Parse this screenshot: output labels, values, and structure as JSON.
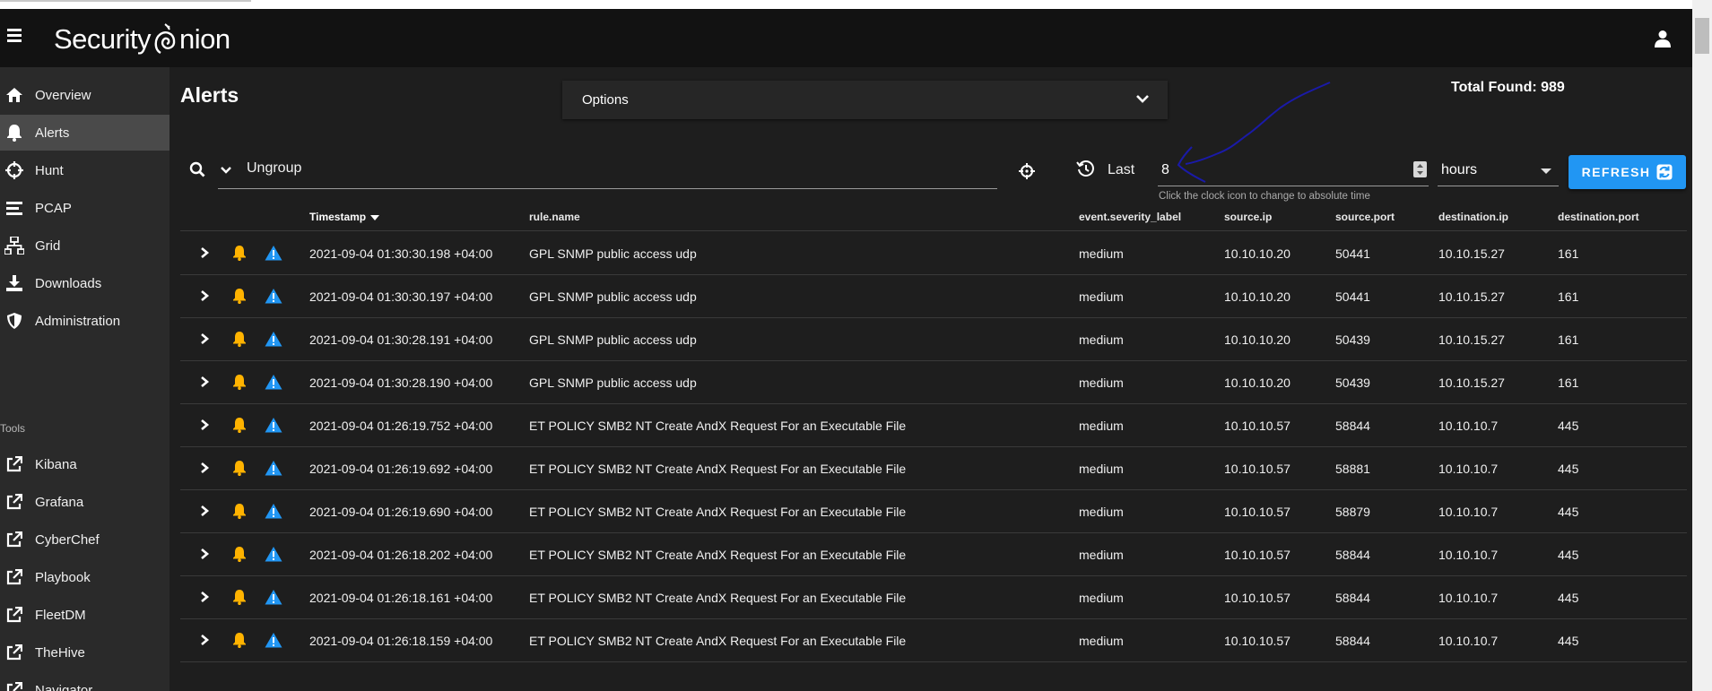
{
  "app": {
    "brand": "Security Onion"
  },
  "sidebar": {
    "items": [
      {
        "label": "Overview",
        "icon": "home-icon",
        "active": false
      },
      {
        "label": "Alerts",
        "icon": "bell-icon",
        "active": true
      },
      {
        "label": "Hunt",
        "icon": "crosshair-icon",
        "active": false
      },
      {
        "label": "PCAP",
        "icon": "list-bars-icon",
        "active": false
      },
      {
        "label": "Grid",
        "icon": "sitemap-icon",
        "active": false
      },
      {
        "label": "Downloads",
        "icon": "download-icon",
        "active": false
      },
      {
        "label": "Administration",
        "icon": "shield-icon",
        "active": false
      }
    ],
    "tools_label": "Tools",
    "tools": [
      {
        "label": "Kibana",
        "icon": "external-link-icon"
      },
      {
        "label": "Grafana",
        "icon": "external-link-icon"
      },
      {
        "label": "CyberChef",
        "icon": "external-link-icon"
      },
      {
        "label": "Playbook",
        "icon": "external-link-icon"
      },
      {
        "label": "FleetDM",
        "icon": "external-link-icon"
      },
      {
        "label": "TheHive",
        "icon": "external-link-icon"
      },
      {
        "label": "Navigator",
        "icon": "external-link-icon"
      }
    ]
  },
  "main": {
    "title": "Alerts",
    "options_label": "Options",
    "total_found": "Total Found: 989"
  },
  "query": {
    "text": "Ungroup",
    "last_label": "Last",
    "last_value": "8",
    "hint": "Click the clock icon to change to absolute time",
    "unit": "hours",
    "refresh_label": "REFRESH"
  },
  "table": {
    "columns": [
      "Timestamp",
      "rule.name",
      "event.severity_label",
      "source.ip",
      "source.port",
      "destination.ip",
      "destination.port"
    ],
    "rows": [
      [
        "2021-09-04 01:30:30.198 +04:00",
        "GPL SNMP public access udp",
        "medium",
        "10.10.10.20",
        "50441",
        "10.10.15.27",
        "161"
      ],
      [
        "2021-09-04 01:30:30.197 +04:00",
        "GPL SNMP public access udp",
        "medium",
        "10.10.10.20",
        "50441",
        "10.10.15.27",
        "161"
      ],
      [
        "2021-09-04 01:30:28.191 +04:00",
        "GPL SNMP public access udp",
        "medium",
        "10.10.10.20",
        "50439",
        "10.10.15.27",
        "161"
      ],
      [
        "2021-09-04 01:30:28.190 +04:00",
        "GPL SNMP public access udp",
        "medium",
        "10.10.10.20",
        "50439",
        "10.10.15.27",
        "161"
      ],
      [
        "2021-09-04 01:26:19.752 +04:00",
        "ET POLICY SMB2 NT Create AndX Request For an Executable File",
        "medium",
        "10.10.10.57",
        "58844",
        "10.10.10.7",
        "445"
      ],
      [
        "2021-09-04 01:26:19.692 +04:00",
        "ET POLICY SMB2 NT Create AndX Request For an Executable File",
        "medium",
        "10.10.10.57",
        "58881",
        "10.10.10.7",
        "445"
      ],
      [
        "2021-09-04 01:26:19.690 +04:00",
        "ET POLICY SMB2 NT Create AndX Request For an Executable File",
        "medium",
        "10.10.10.57",
        "58879",
        "10.10.10.7",
        "445"
      ],
      [
        "2021-09-04 01:26:18.202 +04:00",
        "ET POLICY SMB2 NT Create AndX Request For an Executable File",
        "medium",
        "10.10.10.57",
        "58844",
        "10.10.10.7",
        "445"
      ],
      [
        "2021-09-04 01:26:18.161 +04:00",
        "ET POLICY SMB2 NT Create AndX Request For an Executable File",
        "medium",
        "10.10.10.57",
        "58844",
        "10.10.10.7",
        "445"
      ],
      [
        "2021-09-04 01:26:18.159 +04:00",
        "ET POLICY SMB2 NT Create AndX Request For an Executable File",
        "medium",
        "10.10.10.57",
        "58844",
        "10.10.10.7",
        "445"
      ]
    ]
  },
  "colors": {
    "accent": "#2196f3",
    "bell": "#ffb300",
    "warning": "#2196f3",
    "annotation": "#1a1aa8"
  }
}
